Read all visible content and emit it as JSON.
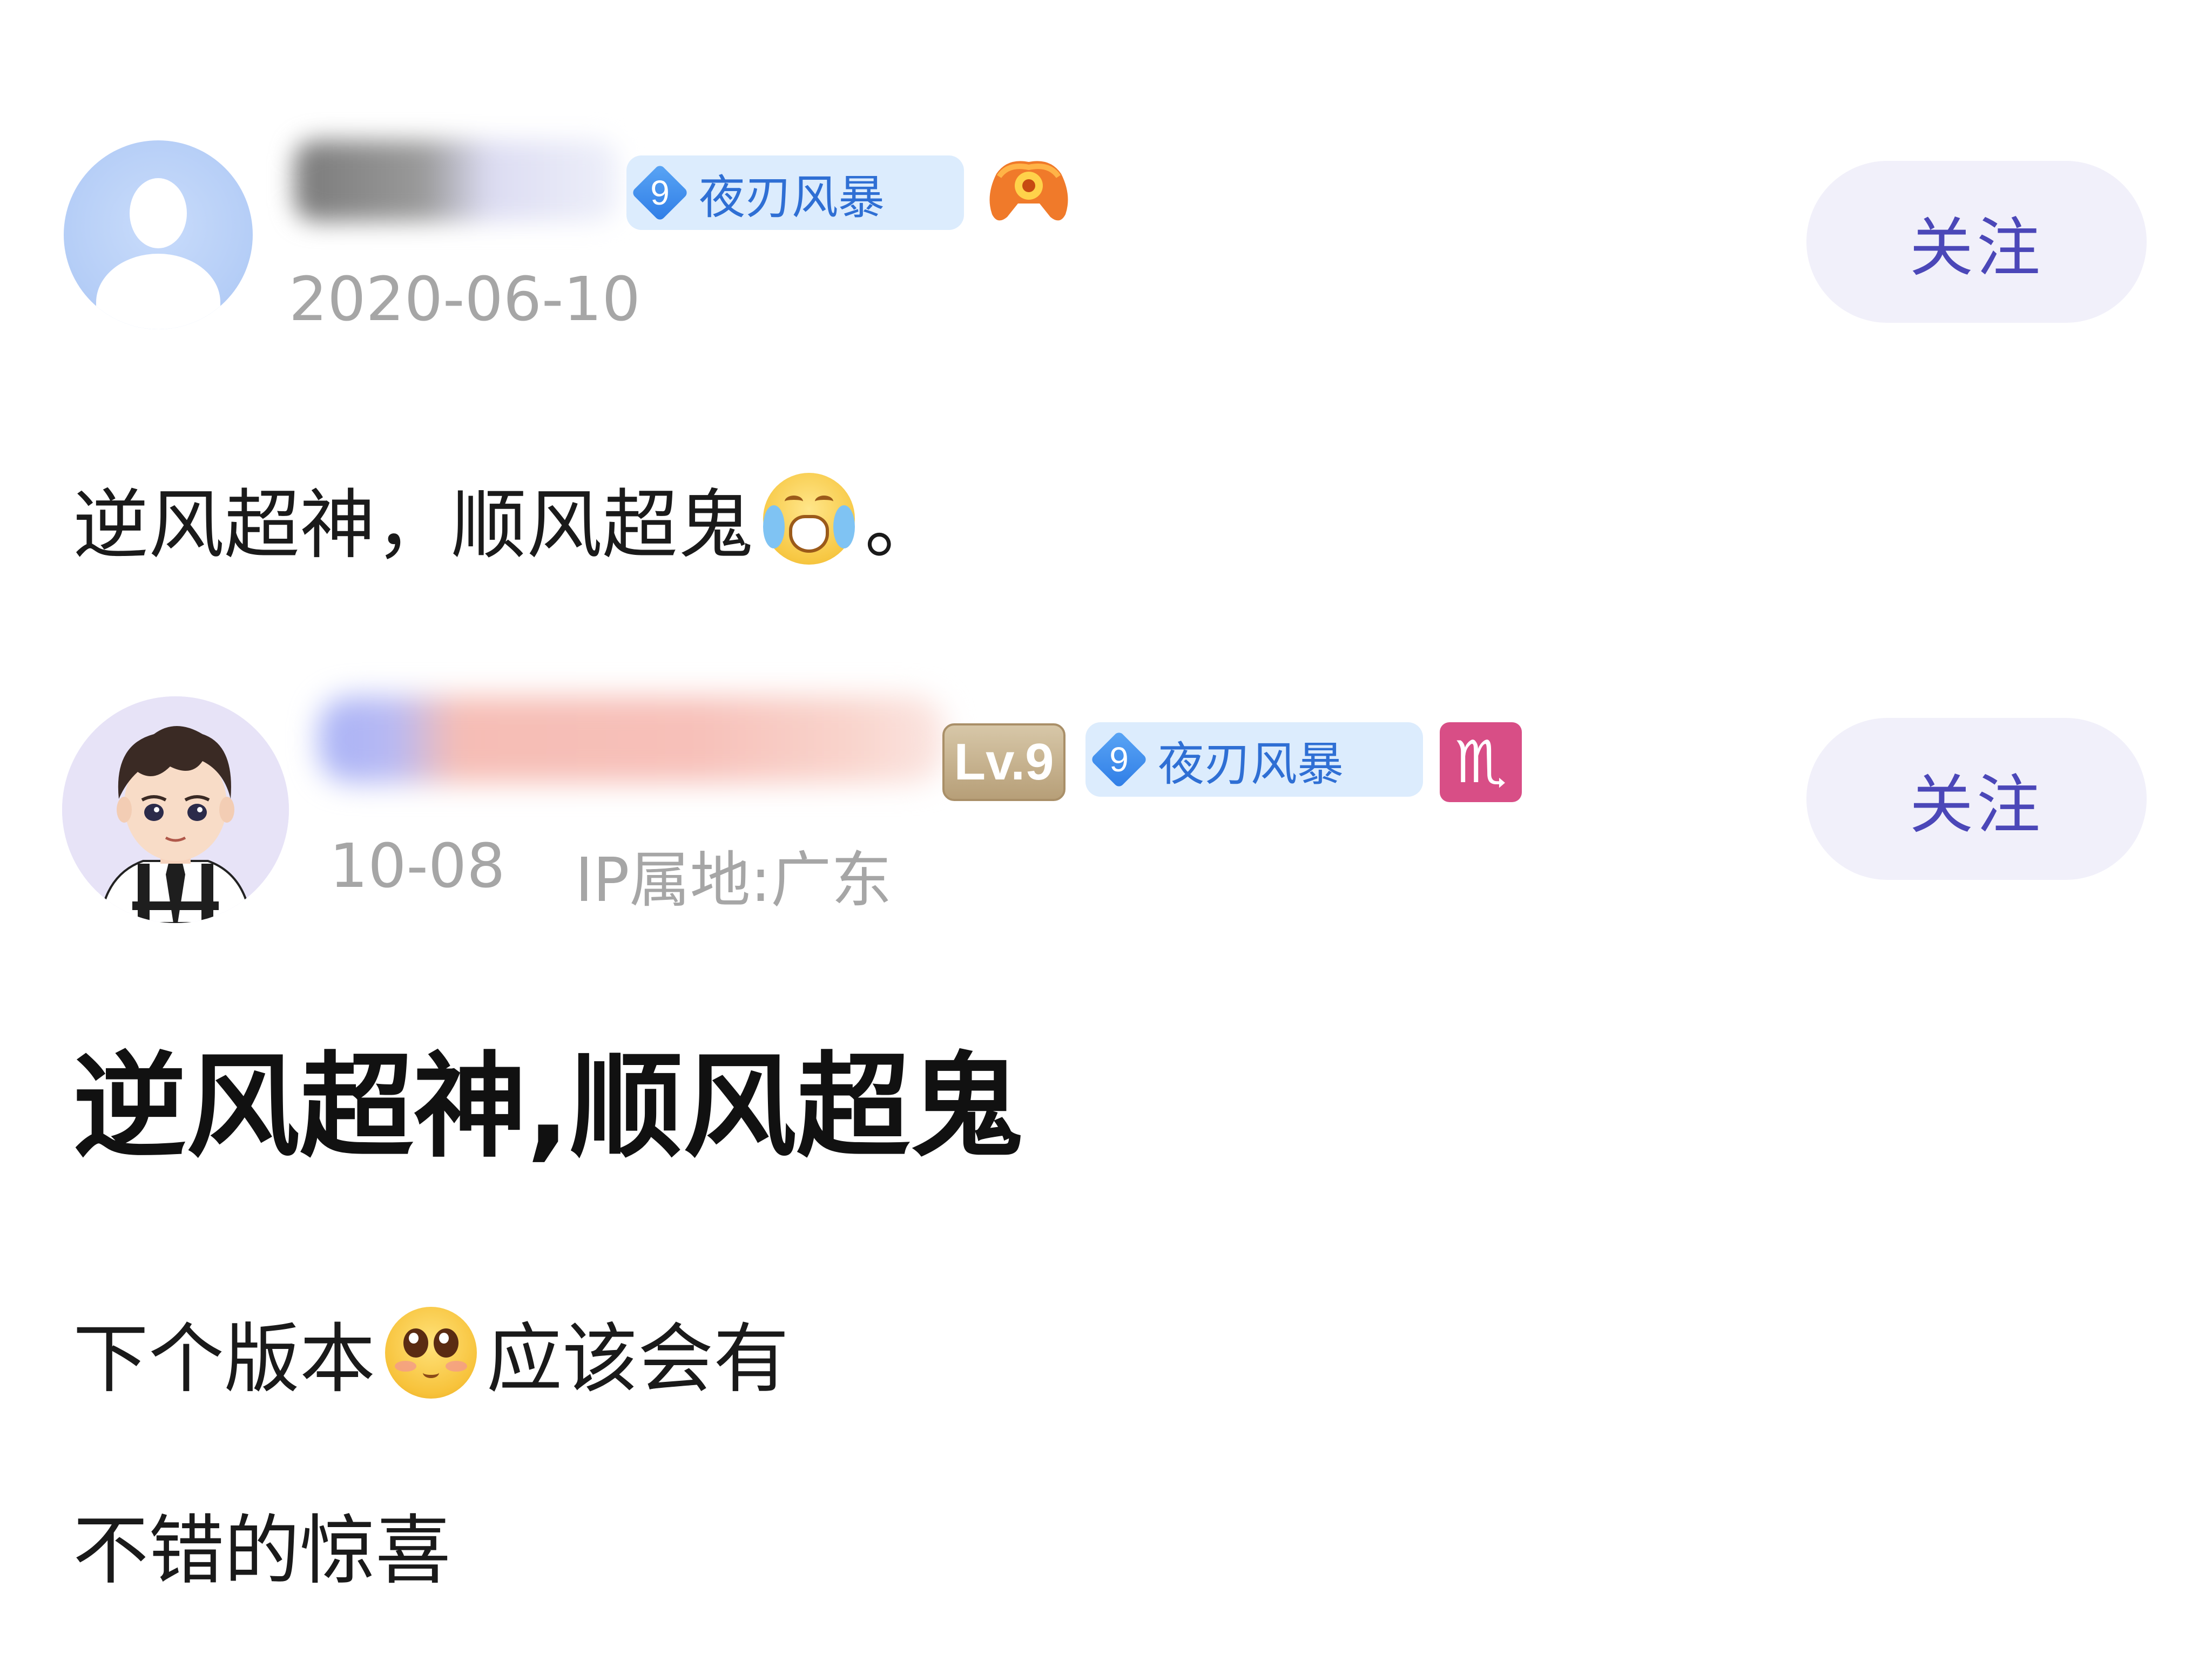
{
  "comments": [
    {
      "id_hint": "comment-1",
      "rank_badge": {
        "level": "9",
        "name": "夜刃风暴"
      },
      "date": "2020-06-10",
      "follow_label": "关注",
      "body_before_emoji": "逆风超神，顺风超鬼",
      "body_after_emoji": "。"
    },
    {
      "id_hint": "comment-2",
      "lv_badge": "Lv.9",
      "rank_badge": {
        "level": "9",
        "name": "夜刃风暴"
      },
      "zodiac": "♏",
      "date": "10-08",
      "ip": "IP属地:广东",
      "follow_label": "关注",
      "title": "逆风超神,顺风超鬼",
      "line1_before_emoji": "下个版本",
      "line1_after_emoji": "应该会有",
      "line2": "不错的惊喜"
    }
  ],
  "icons": {
    "avatar1": "default-avatar-icon",
    "avatar2": "cartoon-boy-avatar",
    "game": "gamepad-icon",
    "emoji1": "crying-face-emoji",
    "emoji2": "pleading-face-emoji"
  },
  "colors": {
    "follow_text": "#4b47b8",
    "follow_bg": "#f1f0fa",
    "rank_text": "#2f6fd4",
    "rank_bg": "#dcecfd",
    "date_text": "#a6a6a6",
    "zodiac_bg": "#d84e86"
  }
}
